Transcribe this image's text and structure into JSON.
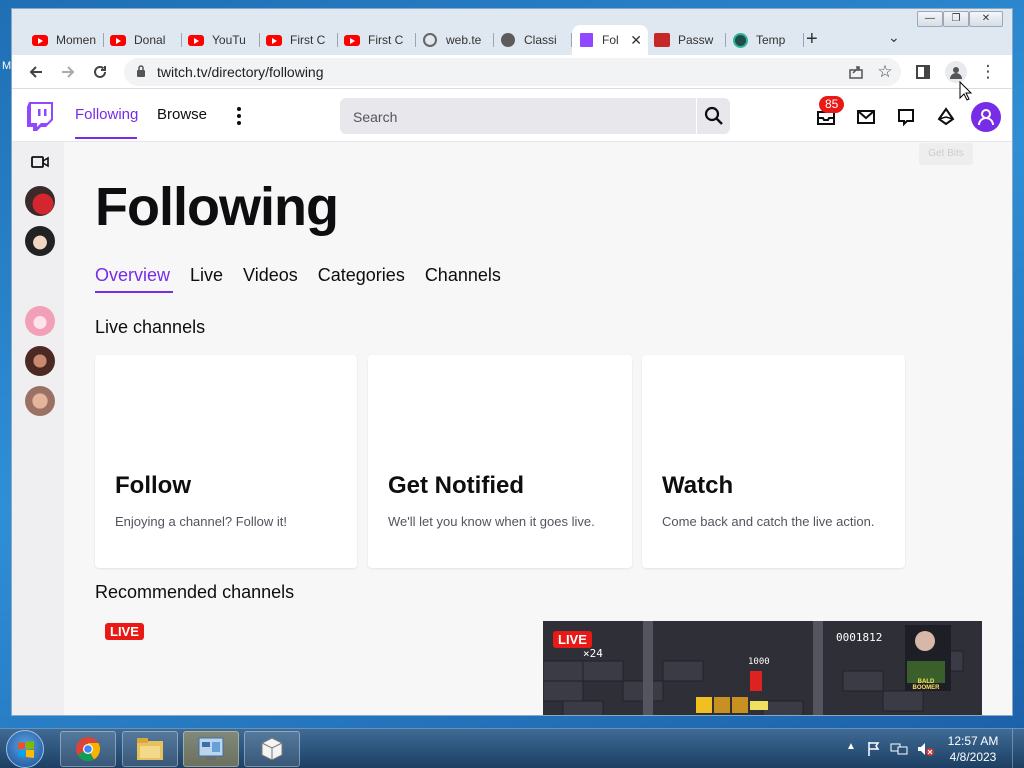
{
  "desktop": {
    "side_text": "M"
  },
  "browser": {
    "tabs": [
      {
        "title": "Momen",
        "icon": "youtube-icon"
      },
      {
        "title": "Donal",
        "icon": "youtube-icon"
      },
      {
        "title": "YouTu",
        "icon": "youtube-icon"
      },
      {
        "title": "First C",
        "icon": "youtube-icon"
      },
      {
        "title": "First C",
        "icon": "youtube-icon"
      },
      {
        "title": "web.te",
        "icon": "globe-icon"
      },
      {
        "title": "Classi",
        "icon": "classic-icon"
      },
      {
        "title": "Fol",
        "icon": "twitch-icon",
        "active": true
      },
      {
        "title": "Passw",
        "icon": "password-icon"
      },
      {
        "title": "Temp",
        "icon": "temp-icon"
      }
    ],
    "url": "twitch.tv/directory/following"
  },
  "twitch": {
    "nav": {
      "following": "Following",
      "browse": "Browse",
      "search_placeholder": "Search",
      "notif_count": "85",
      "tooltip": "Get Bits"
    },
    "title": "Following",
    "subtabs": [
      "Overview",
      "Live",
      "Videos",
      "Categories",
      "Channels"
    ],
    "live_channels_heading": "Live channels",
    "cards": [
      {
        "heading": "Follow",
        "text": "Enjoying a channel? Follow it!"
      },
      {
        "heading": "Get Notified",
        "text": "We'll let you know when it goes live."
      },
      {
        "heading": "Watch",
        "text": "Come back and catch the live action."
      }
    ],
    "recommended_heading": "Recommended channels",
    "live_label": "LIVE",
    "thumb": {
      "score": "0001812",
      "multiplier": "×24",
      "points": "1000",
      "banner": "BALD BOOMER"
    }
  },
  "taskbar": {
    "time": "12:57 AM",
    "date": "4/8/2023"
  },
  "colors": {
    "twitch_purple": "#772ce8",
    "live_red": "#e91916"
  }
}
